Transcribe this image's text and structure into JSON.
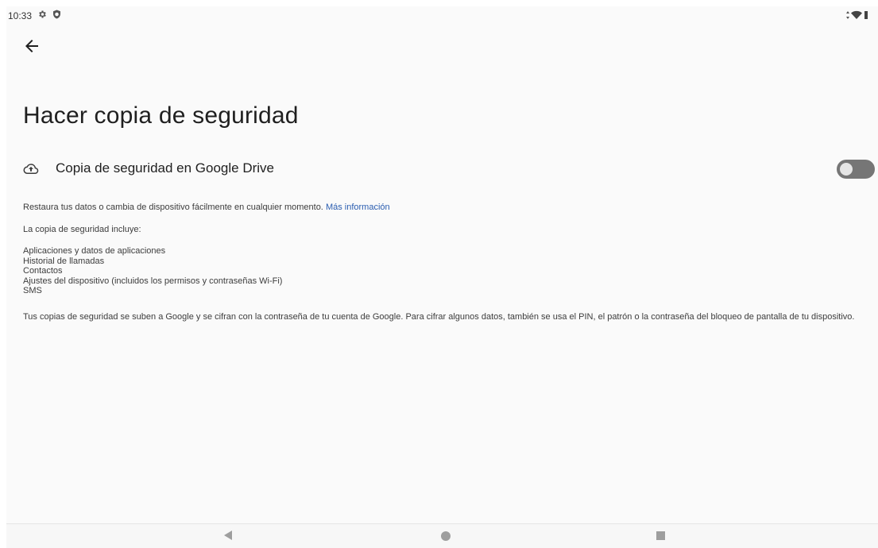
{
  "status_bar": {
    "time": "10:33",
    "left_icons": [
      "gear-icon",
      "shield-icon"
    ],
    "right_icons": [
      "data-arrows-icon",
      "wifi-icon",
      "battery-icon"
    ]
  },
  "header": {
    "back_icon": "arrow-left-icon",
    "title": "Hacer copia de seguridad"
  },
  "backup_setting": {
    "icon": "cloud-upload-icon",
    "label": "Copia de seguridad en Google Drive",
    "toggle_on": false
  },
  "info": {
    "restore_text": "Restaura tus datos o cambia de dispositivo fácilmente en cualquier momento.",
    "learn_more_link": "Más información",
    "includes_title": "La copia de seguridad incluye:",
    "includes_items": [
      "Aplicaciones y datos de aplicaciones",
      "Historial de llamadas",
      "Contactos",
      "Ajustes del dispositivo (incluidos los permisos y contraseñas Wi-Fi)",
      "SMS"
    ],
    "encryption_text": "Tus copias de seguridad se suben a Google y se cifran con la contraseña de tu cuenta de Google. Para cifrar algunos datos, también se usa el PIN, el patrón o la contraseña del bloqueo de pantalla de tu dispositivo."
  },
  "nav_bar": {
    "buttons": [
      "nav-back-icon",
      "nav-home-icon",
      "nav-recents-icon"
    ]
  },
  "colors": {
    "background": "#fafafa",
    "link": "#2a5db0",
    "toggle_track_off": "#767676",
    "toggle_thumb_off": "#e6e6e6"
  }
}
